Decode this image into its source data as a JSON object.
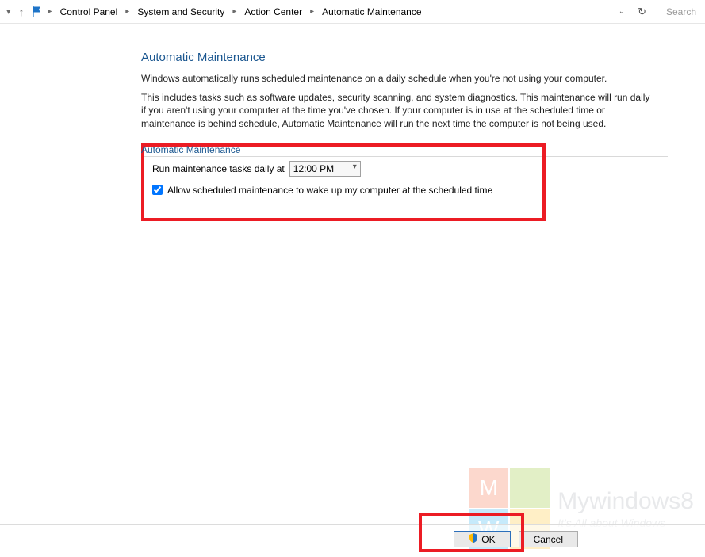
{
  "breadcrumb": {
    "items": [
      "Control Panel",
      "System and Security",
      "Action Center",
      "Automatic Maintenance"
    ],
    "search_placeholder": "Search"
  },
  "page": {
    "title": "Automatic Maintenance",
    "para1": "Windows automatically runs scheduled maintenance on a daily schedule when you're not using your computer.",
    "para2": "This includes tasks such as software updates, security scanning, and system diagnostics. This maintenance will run daily if you aren't using your computer at the time you've chosen. If your computer is in use at the scheduled time or maintenance is behind schedule, Automatic Maintenance will run the next time the computer is not being used.",
    "section_label": "Automatic Maintenance"
  },
  "settings": {
    "run_label": "Run maintenance tasks daily at",
    "time_value": "12:00 PM",
    "allow_wake_label": "Allow scheduled maintenance to wake up my computer at the scheduled time",
    "allow_wake_checked": true
  },
  "buttons": {
    "ok": "OK",
    "cancel": "Cancel"
  },
  "watermark": {
    "brand": "Mywindows8",
    "tagline": "It's All about Windows"
  }
}
